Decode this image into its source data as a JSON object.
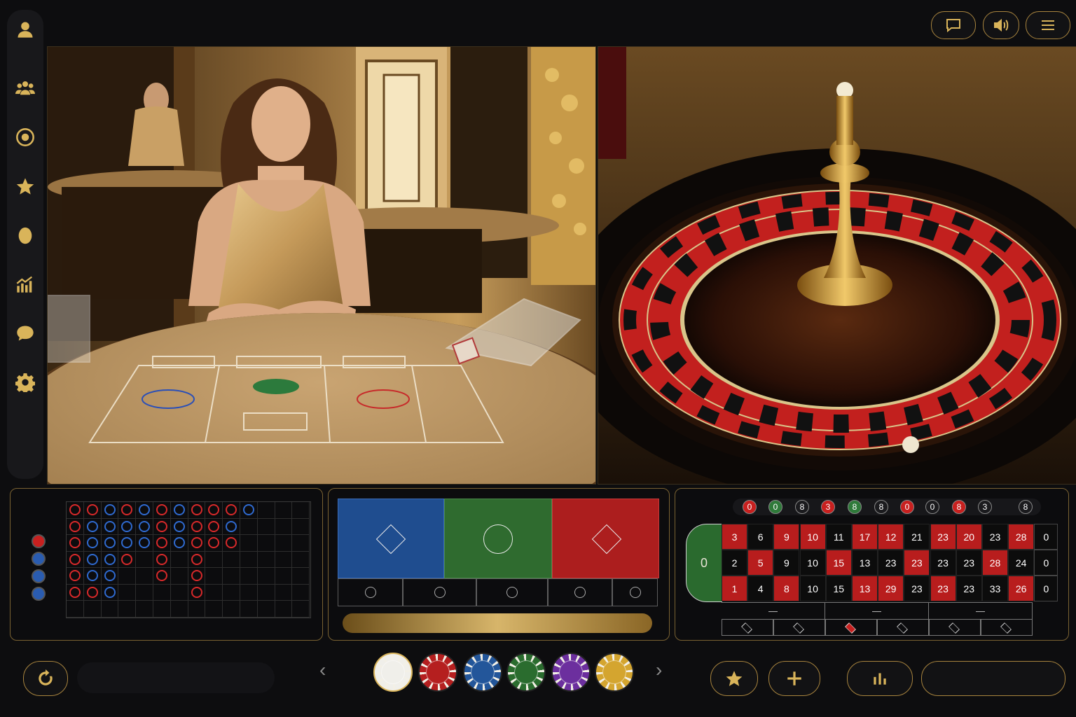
{
  "sidebar": {
    "items": [
      {
        "icon": "user-icon"
      },
      {
        "icon": "players-icon"
      },
      {
        "icon": "target-icon"
      },
      {
        "icon": "star-icon"
      },
      {
        "icon": "egg-icon"
      },
      {
        "icon": "stats-icon"
      },
      {
        "icon": "chat-icon"
      },
      {
        "icon": "gear-icon"
      }
    ]
  },
  "topbar": {
    "buttons": [
      {
        "icon": "chat-bubble-icon"
      },
      {
        "icon": "volume-icon"
      },
      {
        "icon": "menu-icon"
      }
    ]
  },
  "baccarat": {
    "bead_legend": [
      "red",
      "blue",
      "blue",
      "blue"
    ],
    "bet_labels": [
      "○",
      "○",
      "○",
      "○",
      "○"
    ]
  },
  "roulette": {
    "history": [
      "0",
      "0",
      "8",
      "3",
      "8",
      "8",
      "0",
      "0",
      "8",
      "3",
      "8"
    ],
    "history_colors": [
      "red",
      "green",
      "dark",
      "red",
      "green",
      "dark",
      "red",
      "dark",
      "red",
      "dark",
      "dark"
    ],
    "zero": "0",
    "rows": [
      [
        "3",
        "6",
        "9",
        "10",
        "11",
        "17",
        "12",
        "21",
        "23",
        "20",
        "23",
        "28",
        "0"
      ],
      [
        "2",
        "5",
        "9",
        "10",
        "15",
        "13",
        "23",
        "23",
        "23",
        "23",
        "28",
        "24",
        "0"
      ],
      [
        "1",
        "4",
        "8",
        "10",
        "15",
        "13",
        "29",
        "23",
        "23",
        "23",
        "33",
        "26",
        "0"
      ]
    ],
    "row_colors": [
      [
        "red",
        "dark",
        "red",
        "red",
        "dark",
        "red",
        "red",
        "dark",
        "red",
        "red",
        "dark",
        "red",
        "dark"
      ],
      [
        "dark",
        "red",
        "dark",
        "dark",
        "red",
        "dark",
        "dark",
        "red",
        "dark",
        "dark",
        "red",
        "dark",
        "dark"
      ],
      [
        "red",
        "dark",
        "red",
        "dark",
        "dark",
        "red",
        "red",
        "dark",
        "red",
        "dark",
        "dark",
        "red",
        "dark"
      ]
    ],
    "dozens": [
      "—",
      "—",
      "—"
    ]
  },
  "colors": {
    "accent": "#d9b45a",
    "panel_border": "#7a6232",
    "red": "#c8201f",
    "blue": "#2a5cb0",
    "green": "#2f7a3a"
  },
  "chips": [
    {
      "color": "#f0efea"
    },
    {
      "color": "#b51f1f"
    },
    {
      "color": "#23569a"
    },
    {
      "color": "#2a6c2e"
    },
    {
      "color": "#6c2f9e"
    },
    {
      "color": "#d4a52f"
    }
  ]
}
